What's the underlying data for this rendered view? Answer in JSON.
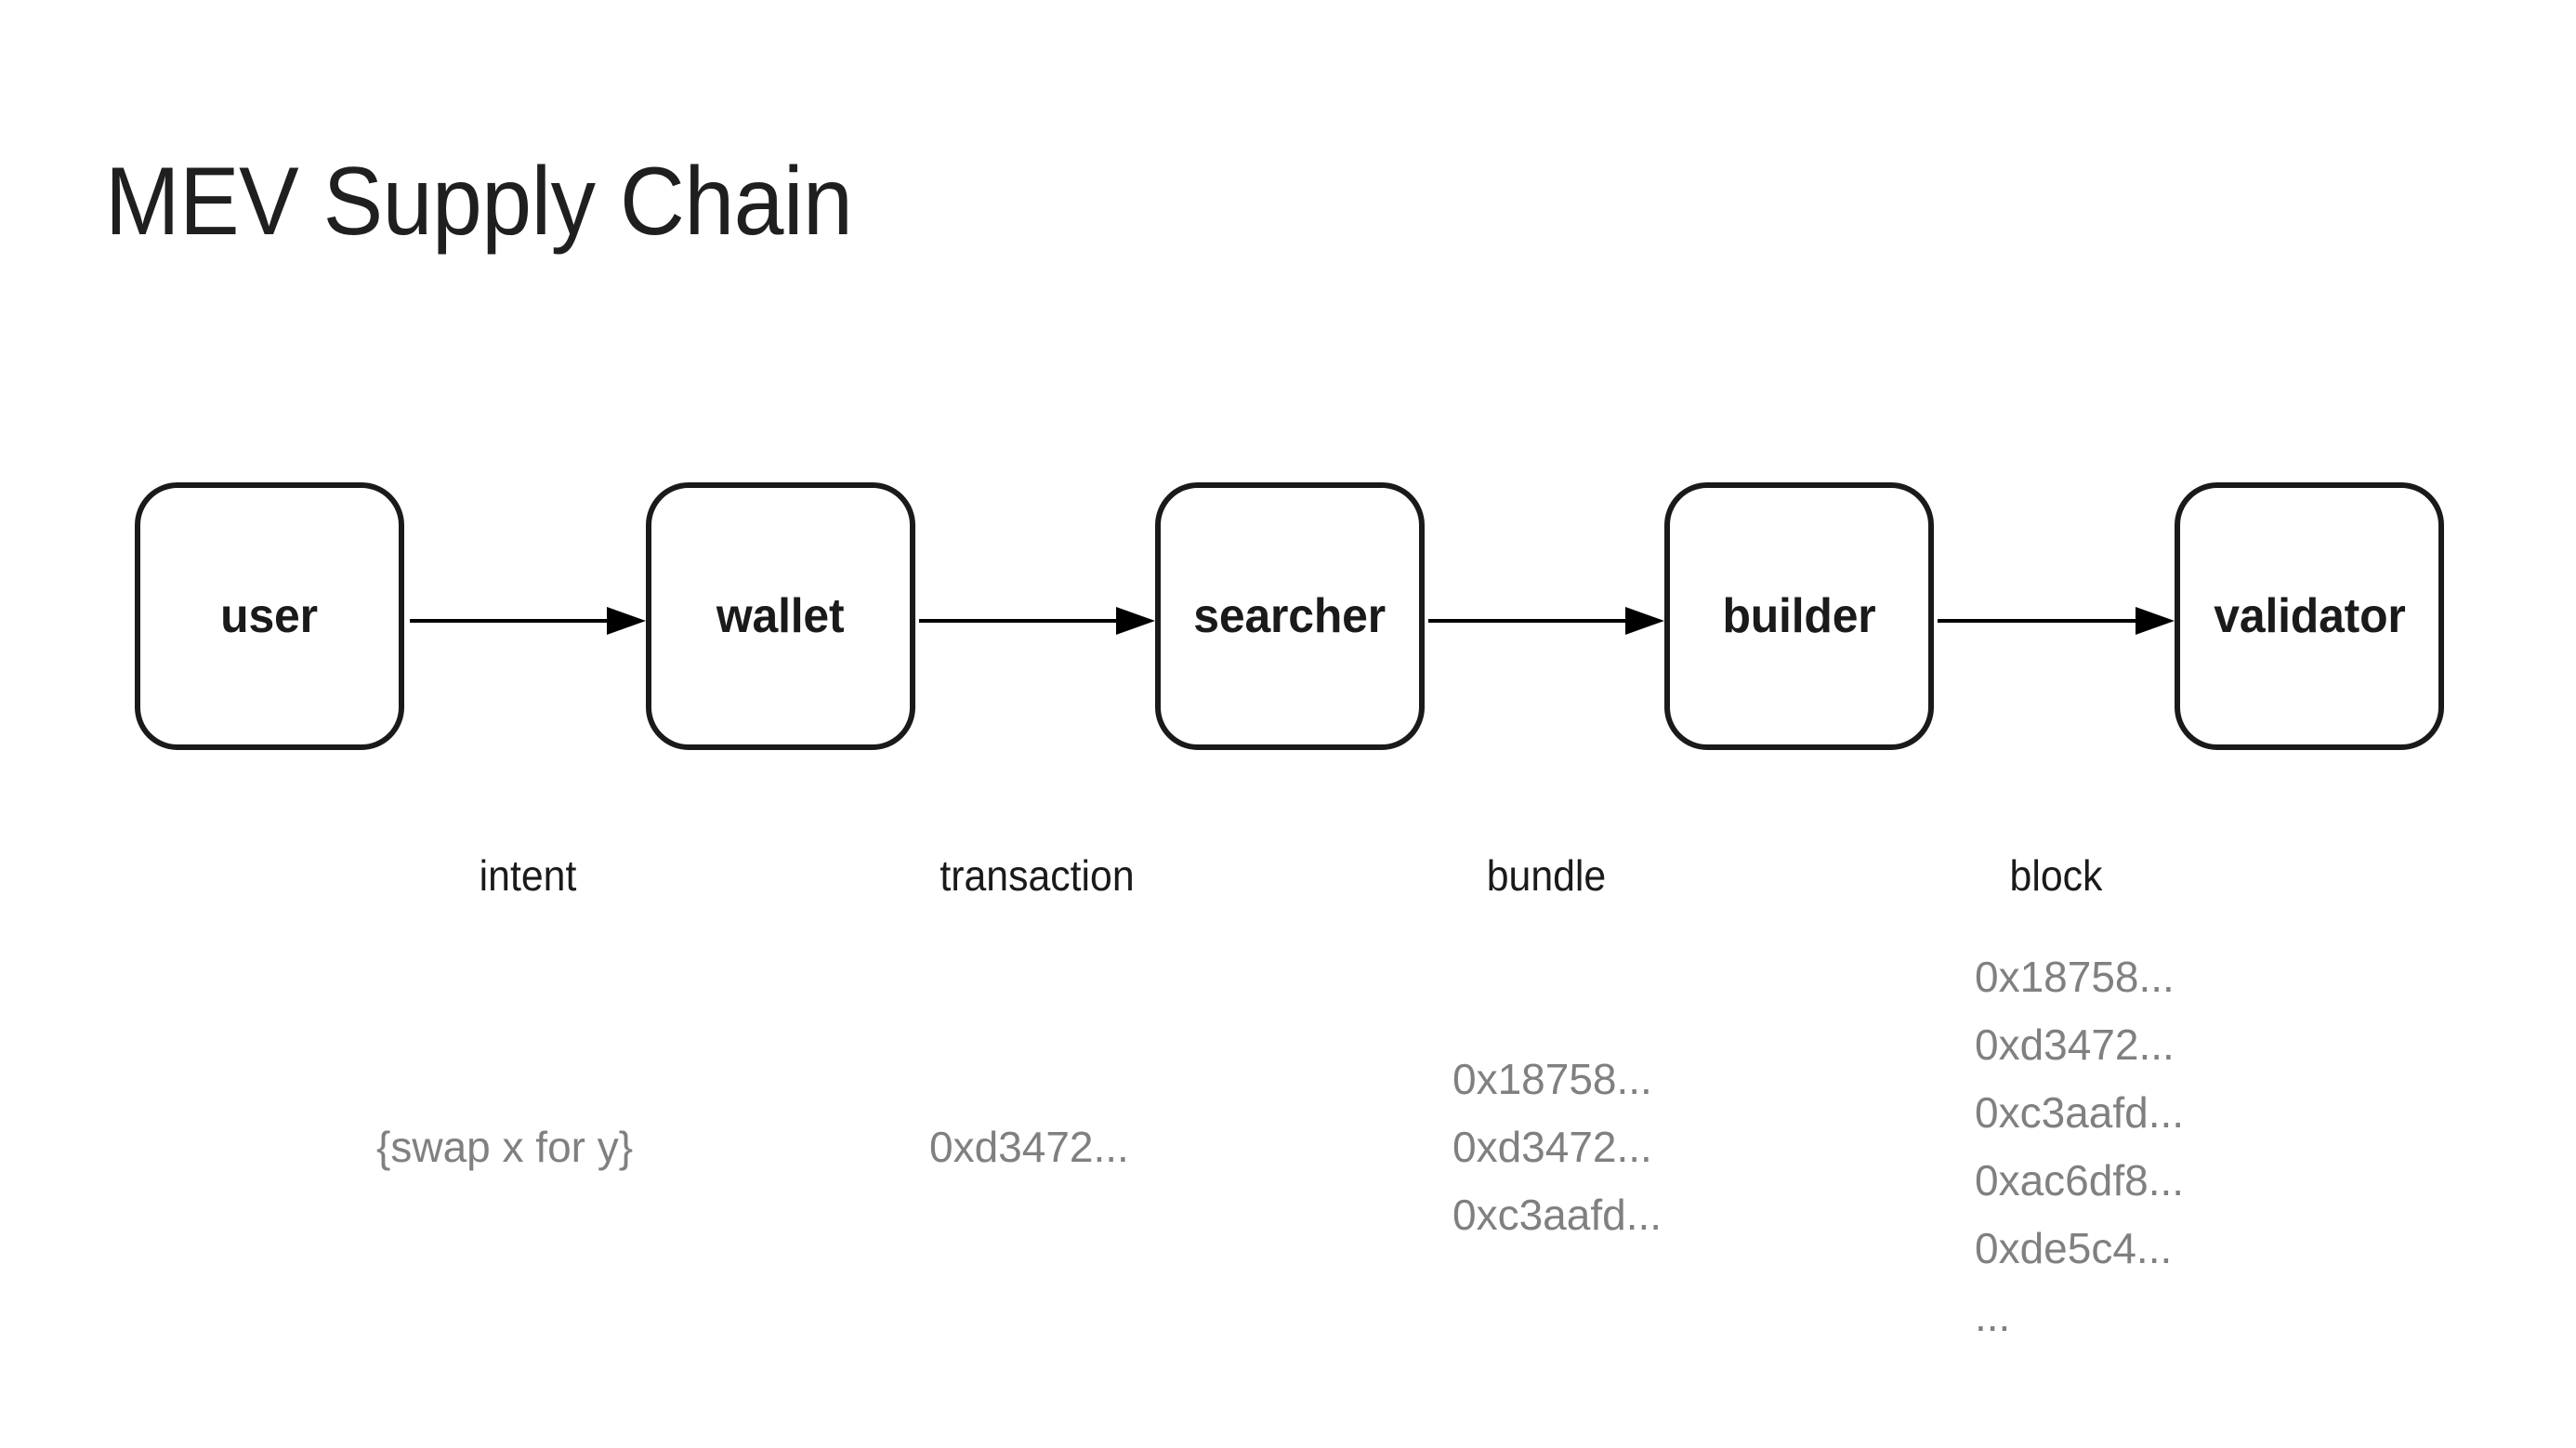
{
  "page": {
    "title": "MEV Supply Chain",
    "background_color": "#ffffff",
    "ink_color": "#1a1a1a",
    "muted_color": "#808080"
  },
  "chart_data": {
    "type": "diagram",
    "title": "MEV Supply Chain",
    "nodes": [
      {
        "id": "user",
        "label": "user"
      },
      {
        "id": "wallet",
        "label": "wallet"
      },
      {
        "id": "searcher",
        "label": "searcher"
      },
      {
        "id": "builder",
        "label": "builder"
      },
      {
        "id": "validator",
        "label": "validator"
      }
    ],
    "edges": [
      {
        "from": "user",
        "to": "wallet",
        "label": "intent",
        "payload": [
          "{swap x for y}"
        ]
      },
      {
        "from": "wallet",
        "to": "searcher",
        "label": "transaction",
        "payload": [
          "0xd3472..."
        ]
      },
      {
        "from": "searcher",
        "to": "builder",
        "label": "bundle",
        "payload": [
          "0x18758...",
          "0xd3472...",
          "0xc3aafd..."
        ]
      },
      {
        "from": "builder",
        "to": "validator",
        "label": "block",
        "payload": [
          "0x18758...",
          "0xd3472...",
          "0xc3aafd...",
          "0xac6df8...",
          "0xde5c4...",
          "..."
        ]
      }
    ]
  },
  "nodes": {
    "user": {
      "label": "user"
    },
    "wallet": {
      "label": "wallet"
    },
    "searcher": {
      "label": "searcher"
    },
    "builder": {
      "label": "builder"
    },
    "validator": {
      "label": "validator"
    }
  },
  "edges": {
    "intent": {
      "label": "intent"
    },
    "transaction": {
      "label": "transaction"
    },
    "bundle": {
      "label": "bundle"
    },
    "block": {
      "label": "block"
    }
  },
  "payloads": {
    "intent": {
      "l0": "{swap x for y}"
    },
    "transaction": {
      "l0": "0xd3472..."
    },
    "bundle": {
      "l0": "0x18758...",
      "l1": "0xd3472...",
      "l2": "0xc3aafd..."
    },
    "block": {
      "l0": "0x18758...",
      "l1": "0xd3472...",
      "l2": "0xc3aafd...",
      "l3": "0xac6df8...",
      "l4": "0xde5c4...",
      "l5": "..."
    }
  }
}
